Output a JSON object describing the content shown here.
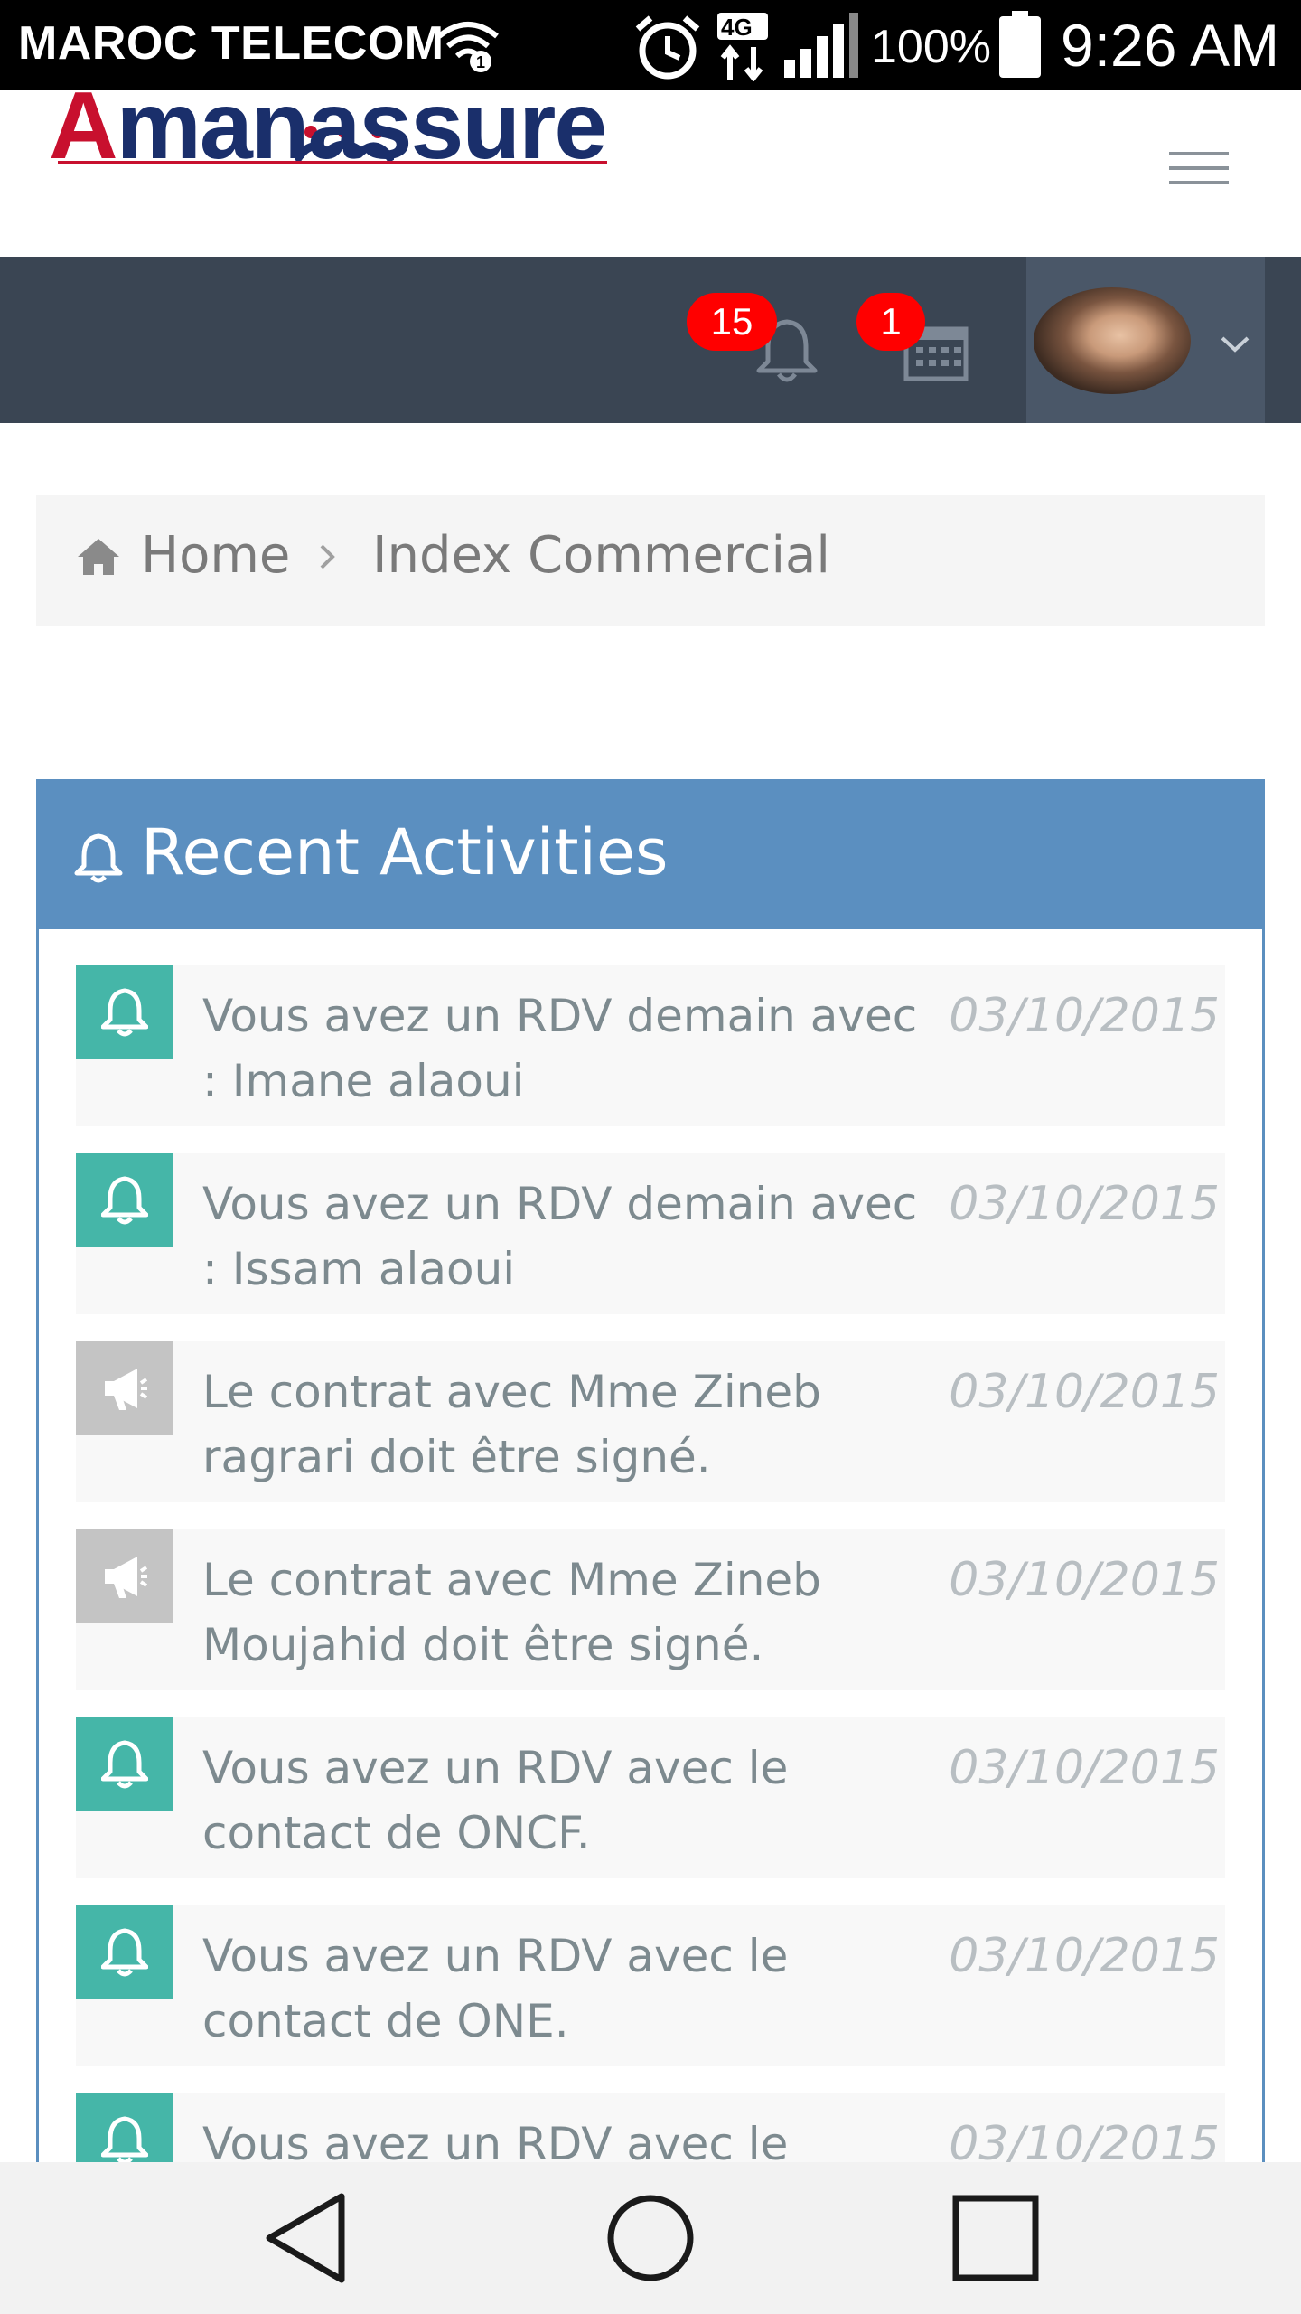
{
  "status_bar": {
    "carrier": "MAROC TELECOM",
    "network": "4G",
    "battery": "100%",
    "time": "9:26 AM"
  },
  "header": {
    "logo_text": "Amanassure",
    "logo_first": "A",
    "logo_rest": "manassure"
  },
  "navbar": {
    "notifications_count": "15",
    "calendar_count": "1"
  },
  "breadcrumb": {
    "home": "Home",
    "current": "Index Commercial"
  },
  "panel": {
    "title": "Recent Activities",
    "items": [
      {
        "icon": "bell-icon",
        "type": "teal",
        "text": "Vous avez un RDV demain avec : Imane alaoui",
        "date": "03/10/2015"
      },
      {
        "icon": "bell-icon",
        "type": "teal",
        "text": "Vous avez un RDV demain avec : Issam alaoui",
        "date": "03/10/2015"
      },
      {
        "icon": "megaphone-icon",
        "type": "gray",
        "text": "Le contrat avec Mme Zineb ragrari doit être signé.",
        "date": "03/10/2015"
      },
      {
        "icon": "megaphone-icon",
        "type": "gray",
        "text": "Le contrat avec Mme Zineb Moujahid doit être signé.",
        "date": "03/10/2015"
      },
      {
        "icon": "bell-icon",
        "type": "teal",
        "text": "Vous avez un RDV avec le contact de ONCF.",
        "date": "03/10/2015"
      },
      {
        "icon": "bell-icon",
        "type": "teal",
        "text": "Vous avez un RDV avec le contact de ONE.",
        "date": "03/10/2015"
      },
      {
        "icon": "bell-icon",
        "type": "teal",
        "text": "Vous avez un RDV avec le",
        "date": "03/10/2015"
      }
    ]
  },
  "colors": {
    "navbar": "#3a4553",
    "panel_header": "#5b8fc0",
    "teal_icon": "#45b6a8",
    "gray_icon": "#c4c4c4",
    "badge": "#ff0000"
  }
}
